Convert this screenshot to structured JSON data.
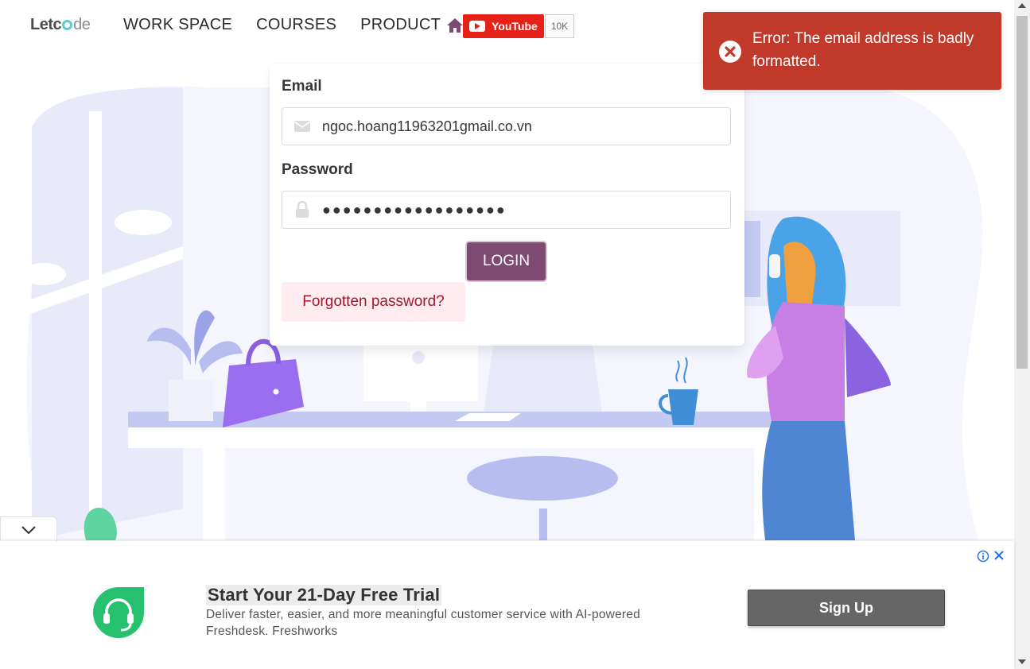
{
  "header": {
    "logo": {
      "prefix": "Letc",
      "suffix": "de"
    },
    "nav": [
      "WORK SPACE",
      "COURSES",
      "PRODUCT"
    ],
    "youtube": {
      "label": "YouTube",
      "count": "10K"
    }
  },
  "login": {
    "email_label": "Email",
    "email_value": "ngoc.hoang11963201gmail.co.vn",
    "password_label": "Password",
    "password_value": "●●●●●●●●●●●●●●●●●●",
    "login_button": "LOGIN",
    "forgot_link": "Forgotten password?"
  },
  "toast": {
    "message": "Error: The email address is badly formatted.",
    "color": "#c0392b"
  },
  "ad": {
    "title": "Start Your 21-Day Free Trial",
    "description": "Deliver faster, easier, and more meaningful customer service with AI-powered Freshdesk. Freshworks",
    "cta": "Sign Up"
  },
  "icons": {
    "home": "home-icon",
    "email": "envelope-icon",
    "password": "lock-icon",
    "toast": "error-x-icon",
    "ad_logo": "headset-icon"
  },
  "colors": {
    "primary": "#7d4a72",
    "danger_light": "#feecf0",
    "danger_text": "#a3182d",
    "youtube": "#e62117",
    "ad_button": "#666666"
  }
}
